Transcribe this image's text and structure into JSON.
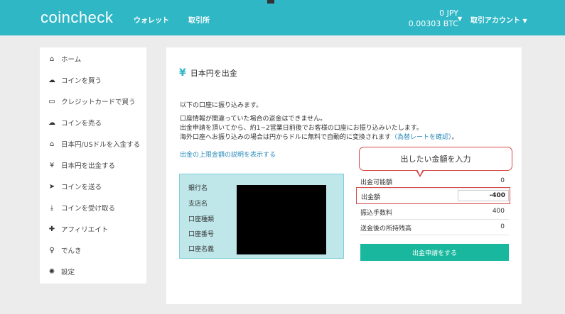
{
  "header": {
    "logo": "coincheck",
    "nav": [
      "ウォレット",
      "取引所"
    ],
    "balance_jpy": "0  JPY",
    "balance_btc": "0.00303  BTC",
    "account": "取引アカウント"
  },
  "sidebar": {
    "items": [
      {
        "label": "ホーム",
        "icon": "home-icon",
        "glyph": "⌂"
      },
      {
        "label": "コインを買う",
        "icon": "cloud-upload-icon",
        "glyph": "☁"
      },
      {
        "label": "クレジットカードで買う",
        "icon": "credit-card-icon",
        "glyph": "▭"
      },
      {
        "label": "コインを売る",
        "icon": "cloud-download-icon",
        "glyph": "☁"
      },
      {
        "label": "日本円/USドルを入金する",
        "icon": "bank-icon",
        "glyph": "⌂"
      },
      {
        "label": "日本円を出金する",
        "icon": "yen-icon",
        "glyph": "¥"
      },
      {
        "label": "コインを送る",
        "icon": "send-icon",
        "glyph": "➤"
      },
      {
        "label": "コインを受け取る",
        "icon": "download-icon",
        "glyph": "⤓"
      },
      {
        "label": "アフィリエイト",
        "icon": "gift-icon",
        "glyph": "✚"
      },
      {
        "label": "でんき",
        "icon": "lightbulb-icon",
        "glyph": "♀"
      },
      {
        "label": "設定",
        "icon": "gear-icon",
        "glyph": "✺"
      }
    ]
  },
  "main": {
    "title_symbol": "¥",
    "title": "日本円を出金",
    "intro": "以下の口座に振り込みます。",
    "note1": "口座情報が間違っていた場合の返金はできません。",
    "note2": "出金申請を頂いてから、約1~2営業日前後でお客様の口座にお振り込みいたします。",
    "note3": "海外口座へお振り込みの場合は円からドルに無料で自動的に変換されます",
    "note3_link": "（為替レートを確認）",
    "note3_tail": "。",
    "limit_link": "出金の上限金額の説明を表示する",
    "bank_labels": [
      "銀行名",
      "支店名",
      "口座種類",
      "口座番号",
      "口座名義"
    ],
    "callout": "出したい金額を入力",
    "available_label": "出金可能額",
    "available_value": "0",
    "amount_label": "出金額",
    "amount_value": "-400",
    "fee_label": "振込手数料",
    "fee_value": "400",
    "after_label": "送金後の所持残高",
    "after_value": "0",
    "submit": "出金申請をする"
  }
}
